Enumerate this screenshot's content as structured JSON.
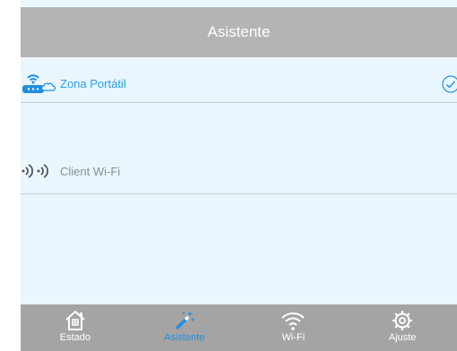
{
  "header": {
    "title": "Asistente"
  },
  "modes": [
    {
      "label": "Zona Portátil",
      "selected": true,
      "icon": "router-cloud-icon"
    },
    {
      "label": "Client Wi-Fi",
      "selected": false,
      "icon": "signal-waves-icon"
    }
  ],
  "tabs": [
    {
      "label": "Estado",
      "icon": "home-icon",
      "active": false
    },
    {
      "label": "Asistente",
      "icon": "magic-wand-icon",
      "active": true
    },
    {
      "label": "Wi-Fi",
      "icon": "wifi-icon",
      "active": false
    },
    {
      "label": "Ajuste",
      "icon": "gear-icon",
      "active": false
    }
  ],
  "colors": {
    "accent": "#1e8fe0",
    "header_bg": "#b4b4b4",
    "tabbar_bg": "#a4a4a4",
    "content_bg": "#e9f6fd"
  }
}
